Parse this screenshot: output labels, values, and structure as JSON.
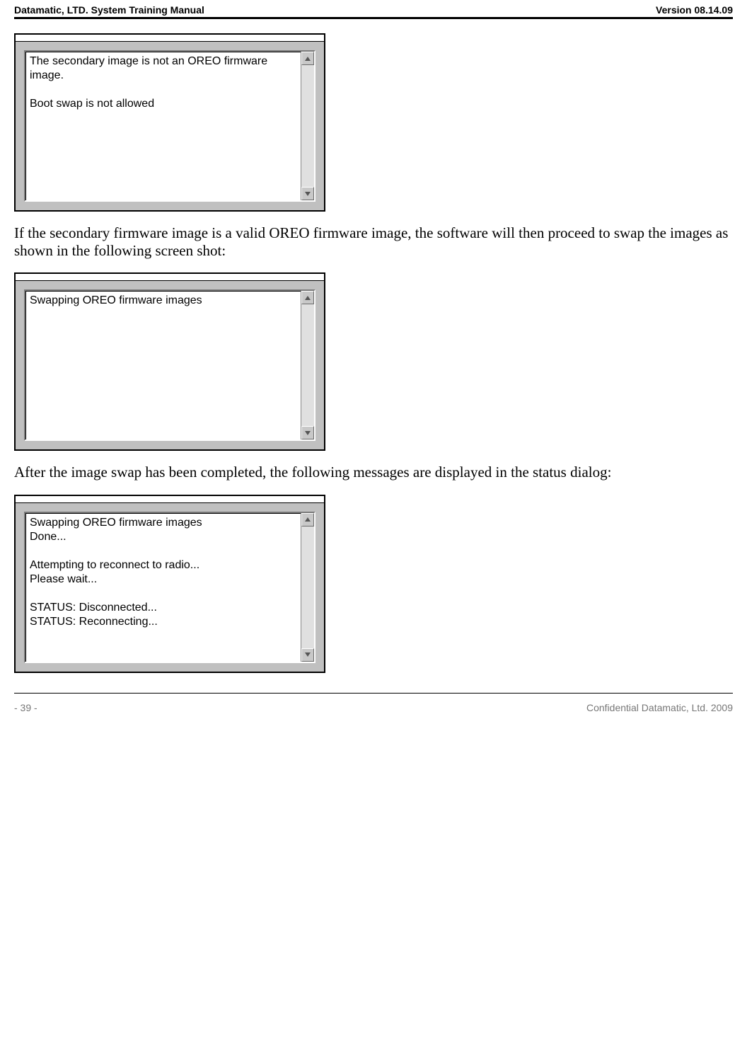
{
  "header": {
    "left": "Datamatic, LTD. System Training  Manual",
    "right": "Version 08.14.09"
  },
  "dialog1": {
    "text": "The secondary image is not an OREO firmware image.\n\nBoot swap is not allowed"
  },
  "para1": "If the secondary firmware image is a valid OREO firmware image, the software will then proceed to swap the images as shown in the following screen shot:",
  "dialog2": {
    "text": "Swapping OREO firmware images"
  },
  "para2": "After the image swap has been completed, the following messages are displayed in the status dialog:",
  "dialog3": {
    "text": "Swapping OREO firmware images\nDone...\n\nAttempting to reconnect to radio...\nPlease wait...\n\nSTATUS: Disconnected...\nSTATUS: Reconnecting..."
  },
  "footer": {
    "left": "- 39 -",
    "right": "Confidential Datamatic, Ltd. 2009"
  }
}
